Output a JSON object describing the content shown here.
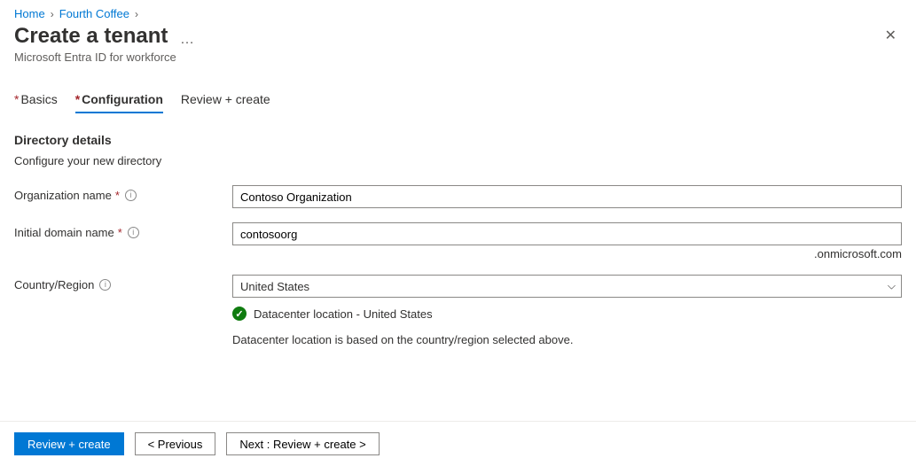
{
  "breadcrumb": {
    "home": "Home",
    "current": "Fourth Coffee"
  },
  "header": {
    "title": "Create a tenant",
    "subtitle": "Microsoft Entra ID for workforce"
  },
  "tabs": {
    "basics": "Basics",
    "configuration": "Configuration",
    "review": "Review + create"
  },
  "section": {
    "title": "Directory details",
    "desc": "Configure your new directory"
  },
  "form": {
    "org_label": "Organization name",
    "org_value": "Contoso Organization",
    "domain_label": "Initial domain name",
    "domain_value": "contosoorg",
    "domain_suffix": ".onmicrosoft.com",
    "country_label": "Country/Region",
    "country_value": "United States",
    "dc_location": "Datacenter location - United States",
    "dc_note": "Datacenter location is based on the country/region selected above."
  },
  "footer": {
    "review": "Review + create",
    "previous": "< Previous",
    "next": "Next : Review + create >"
  }
}
